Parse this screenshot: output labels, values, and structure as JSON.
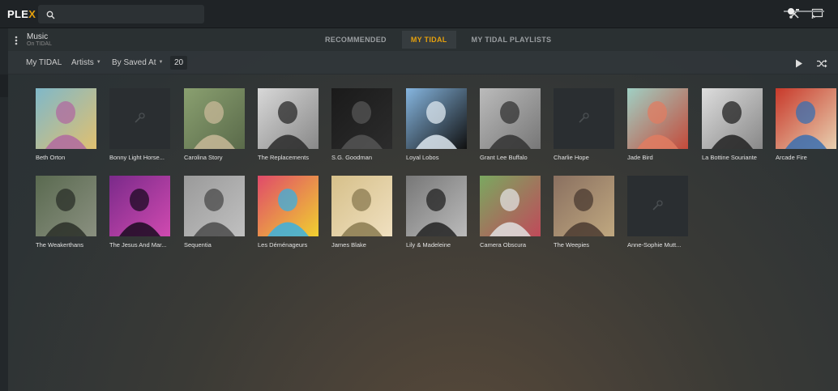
{
  "app": {
    "logo_main": "PLE",
    "logo_accent": "X"
  },
  "search": {
    "placeholder": ""
  },
  "section": {
    "title": "Music",
    "subtitle": "On TIDAL"
  },
  "tabs": [
    {
      "label": "RECOMMENDED",
      "active": false
    },
    {
      "label": "MY TIDAL",
      "active": true
    },
    {
      "label": "MY TIDAL PLAYLISTS",
      "active": false
    }
  ],
  "filters": {
    "source": "My TIDAL",
    "type": "Artists",
    "sort": "By Saved At",
    "count": "20"
  },
  "colors": {
    "accent": "#e5a00d",
    "background": "#2d3335"
  },
  "icons": [
    "search-icon",
    "settings-icon",
    "cast-icon",
    "more-vertical-icon",
    "play-icon",
    "shuffle-icon",
    "microphone-icon"
  ],
  "artists": [
    {
      "name": "Beth Orton",
      "art": "photo"
    },
    {
      "name": "Bonny Light Horse...",
      "art": "placeholder"
    },
    {
      "name": "Carolina Story",
      "art": "photo"
    },
    {
      "name": "The Replacements",
      "art": "photo"
    },
    {
      "name": "S.G. Goodman",
      "art": "photo"
    },
    {
      "name": "Loyal Lobos",
      "art": "photo"
    },
    {
      "name": "Grant Lee Buffalo",
      "art": "photo"
    },
    {
      "name": "Charlie Hope",
      "art": "placeholder"
    },
    {
      "name": "Jade Bird",
      "art": "photo"
    },
    {
      "name": "La Bottine Souriante",
      "art": "photo"
    },
    {
      "name": "Arcade Fire",
      "art": "photo"
    },
    {
      "name": "The Weakerthans",
      "art": "photo"
    },
    {
      "name": "The Jesus And Mar...",
      "art": "photo"
    },
    {
      "name": "Sequentia",
      "art": "photo"
    },
    {
      "name": "Les Déménageurs",
      "art": "photo"
    },
    {
      "name": "James Blake",
      "art": "photo"
    },
    {
      "name": "Lily & Madeleine",
      "art": "photo"
    },
    {
      "name": "Camera Obscura",
      "art": "photo"
    },
    {
      "name": "The Weepies",
      "art": "photo"
    },
    {
      "name": "Anne-Sophie Mutt...",
      "art": "placeholder"
    }
  ]
}
